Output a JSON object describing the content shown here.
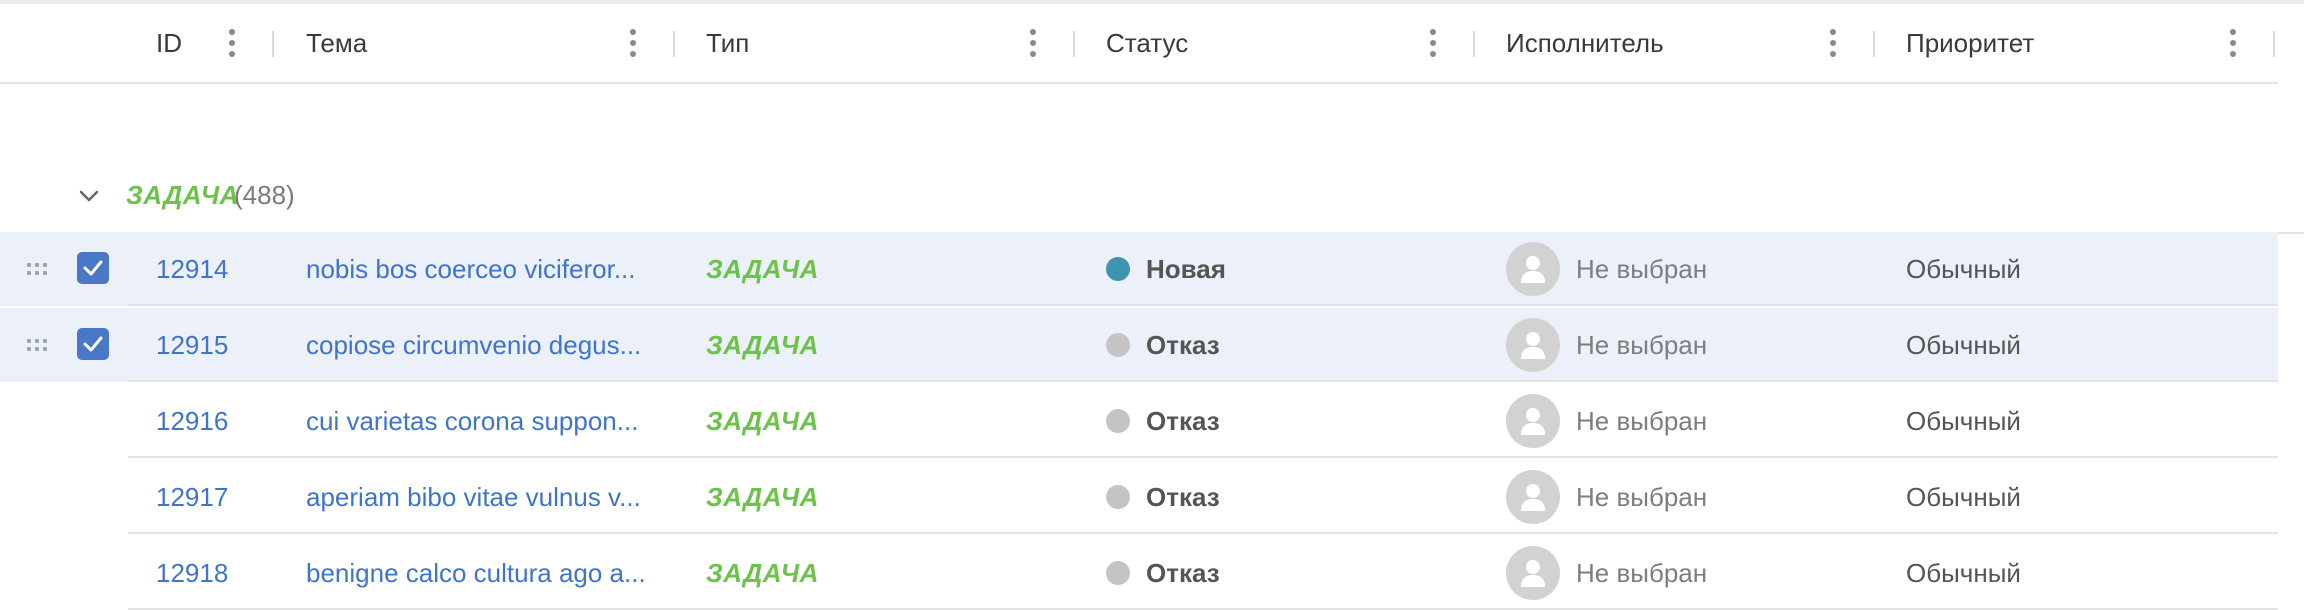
{
  "columns": {
    "id": "ID",
    "subject": "Тема",
    "type": "Тип",
    "status": "Статус",
    "assignee": "Исполнитель",
    "priority": "Приоритет"
  },
  "group": {
    "title": "ЗАДАЧА",
    "count": "(488)"
  },
  "colors": {
    "link": "#3f74c9",
    "type": "#6cc24a",
    "selected_bg": "#ebf0f9",
    "checkbox": "#4a78c7",
    "status_new": "#3d95b0",
    "status_rejected": "#c4c4c4"
  },
  "rows": [
    {
      "id": "12914",
      "subject": "nobis bos coerceo viciferor...",
      "type": "ЗАДАЧА",
      "status": "Новая",
      "status_color": "#3d95b0",
      "assignee": "Не выбран",
      "priority": "Обычный",
      "selected": true
    },
    {
      "id": "12915",
      "subject": "copiose circumvenio degus...",
      "type": "ЗАДАЧА",
      "status": "Отказ",
      "status_color": "#c4c4c4",
      "assignee": "Не выбран",
      "priority": "Обычный",
      "selected": true
    },
    {
      "id": "12916",
      "subject": "cui varietas corona suppon...",
      "type": "ЗАДАЧА",
      "status": "Отказ",
      "status_color": "#c4c4c4",
      "assignee": "Не выбран",
      "priority": "Обычный",
      "selected": false
    },
    {
      "id": "12917",
      "subject": "aperiam bibo vitae vulnus v...",
      "type": "ЗАДАЧА",
      "status": "Отказ",
      "status_color": "#c4c4c4",
      "assignee": "Не выбран",
      "priority": "Обычный",
      "selected": false
    },
    {
      "id": "12918",
      "subject": "benigne calco cultura ago a...",
      "type": "ЗАДАЧА",
      "status": "Отказ",
      "status_color": "#c4c4c4",
      "assignee": "Не выбран",
      "priority": "Обычный",
      "selected": false
    }
  ]
}
